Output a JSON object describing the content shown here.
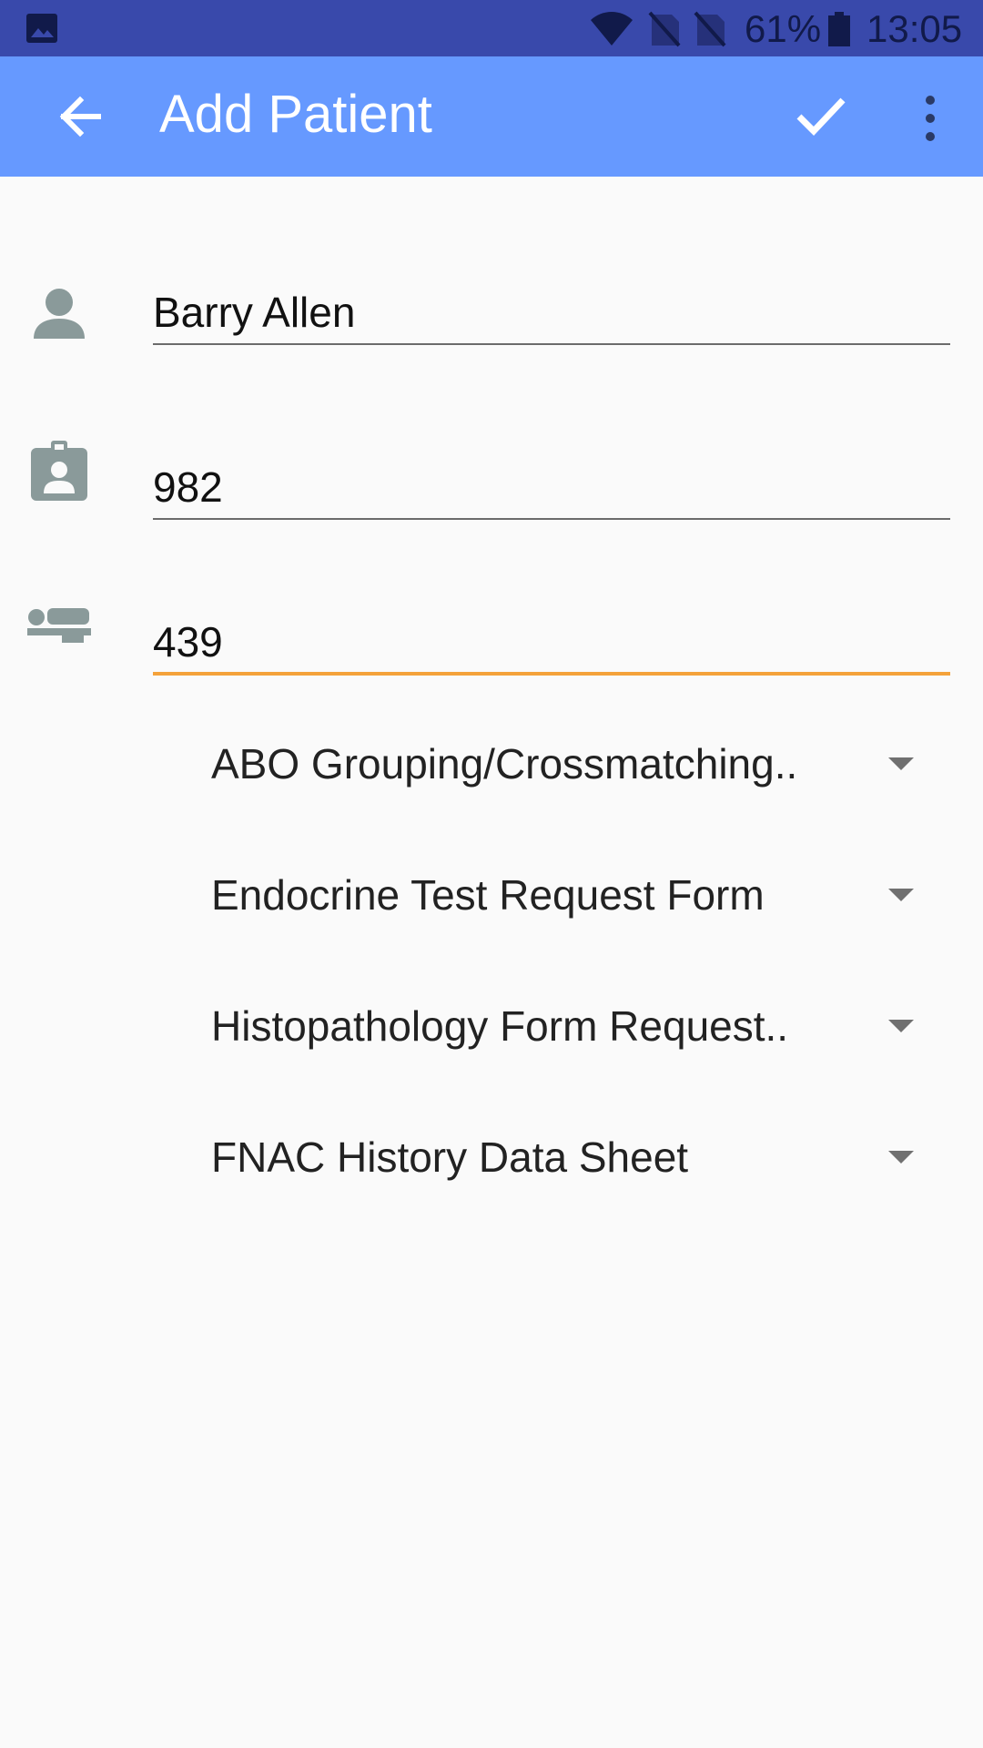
{
  "status_bar": {
    "battery_percent": "61%",
    "time": "13:05",
    "icons": [
      "gallery-icon",
      "wifi-icon",
      "no-sim-icon",
      "no-sim-icon",
      "battery-icon"
    ]
  },
  "app_bar": {
    "title": "Add Patient",
    "back_icon": "arrow-back-icon",
    "confirm_icon": "check-icon",
    "menu_icon": "more-vert-icon",
    "color": "#6699ff"
  },
  "form": {
    "name": {
      "value": "Barry Allen",
      "icon": "person-icon"
    },
    "patient_id": {
      "value": "982",
      "icon": "badge-icon"
    },
    "bed_number": {
      "value": "439",
      "icon": "bed-icon"
    }
  },
  "forms": [
    {
      "label": "ABO Grouping/Crossmatching.."
    },
    {
      "label": "Endocrine Test Request Form"
    },
    {
      "label": "Histopathology Form Request.."
    },
    {
      "label": "FNAC History Data Sheet"
    }
  ],
  "colors": {
    "status_bar": "#3949ab",
    "active_underline": "#f4a23a",
    "icon_gray": "#8a9a9a"
  }
}
